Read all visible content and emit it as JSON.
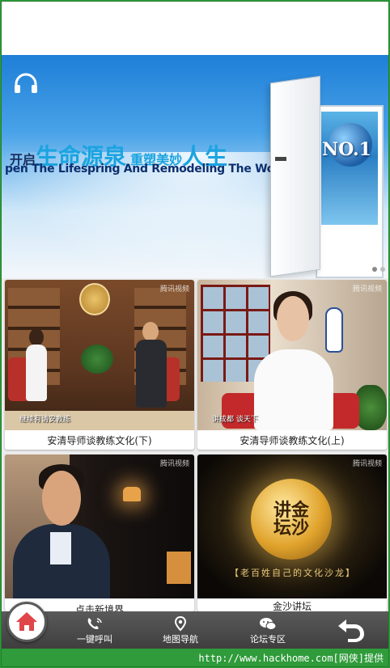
{
  "banner": {
    "slogan_kai": "开启",
    "slogan_main": "生命源泉",
    "slogan_sub": "重塑美妙",
    "slogan_end": "人生",
    "slogan_en": "pen The Lifespring And Remodeling The Wonderful Life.",
    "no1_text": "NO.1",
    "carousel": {
      "total": 2,
      "active_index": 0
    }
  },
  "videos": [
    {
      "caption": "安清导师谈教练文化(下)",
      "subtitle": "继续有请安教练",
      "watermark": "腾讯视频"
    },
    {
      "caption": "安清导师谈教练文化(上)",
      "subtitle": "讲成都 谈天下",
      "watermark": "腾讯视频"
    },
    {
      "caption": "点击新境界",
      "subtitle": "",
      "watermark": "腾讯视频"
    },
    {
      "caption": "金沙讲坛",
      "subtitle": "",
      "watermark": "腾讯视频",
      "coin_text": "讲金\n坛沙",
      "band_text": "【老百姓自己的文化沙龙】"
    }
  ],
  "nav": {
    "home_icon": "home-icon",
    "call_label": "一键呼叫",
    "map_label": "地图导航",
    "forum_label": "论坛专区",
    "back_icon": "back-arrow-icon"
  },
  "footer": {
    "text": "http://www.hackhome.com[网侠]提供"
  },
  "colors": {
    "accent_green": "#2f9b3a",
    "nav_bg": "#4a4a4a",
    "home_red": "#e0454a"
  }
}
